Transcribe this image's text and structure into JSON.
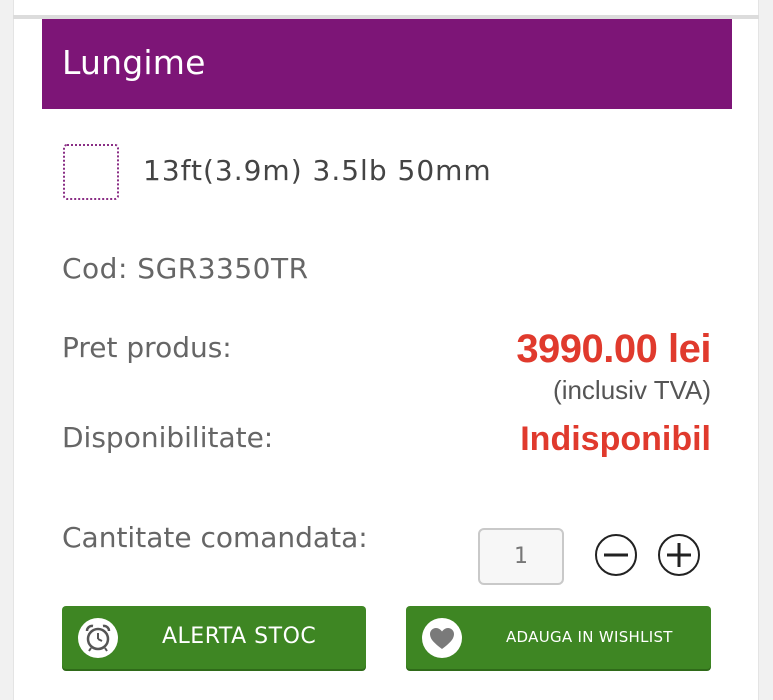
{
  "section": {
    "title": "Lungime"
  },
  "option": {
    "label": "13ft(3.9m) 3.5lb 50mm",
    "checked": false
  },
  "product": {
    "code": "Cod: SGR3350TR",
    "price_label": "Pret produs:",
    "price_value": "3990.00 lei",
    "vat_note": "(inclusiv TVA)",
    "availability_label": "Disponibilitate:",
    "availability_value": "Indisponibil"
  },
  "quantity": {
    "label": "Cantitate comandata:",
    "value": "1",
    "decrement_icon": "minus-icon",
    "increment_icon": "plus-icon"
  },
  "actions": {
    "alert_label": "ALERTA STOC",
    "alert_icon": "alarm-clock-icon",
    "wishlist_label": "ADAUGA IN WISHLIST",
    "wishlist_icon": "heart-icon"
  },
  "colors": {
    "header": "#7d1577",
    "price": "#e03a2d",
    "button": "#3e8623"
  }
}
